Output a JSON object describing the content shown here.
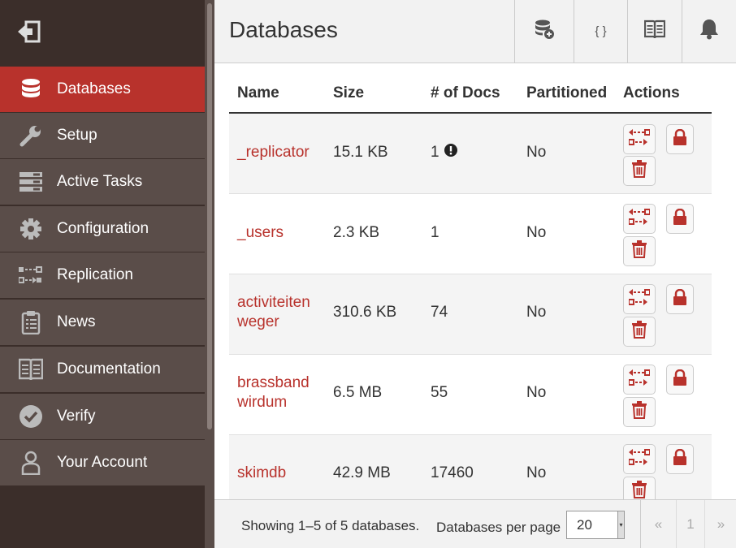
{
  "sidebar": {
    "items": [
      {
        "label": "Databases",
        "icon": "database-icon",
        "active": true
      },
      {
        "label": "Setup",
        "icon": "wrench-icon"
      },
      {
        "label": "Active Tasks",
        "icon": "tasks-icon"
      },
      {
        "label": "Configuration",
        "icon": "gear-icon"
      },
      {
        "label": "Replication",
        "icon": "replication-icon"
      },
      {
        "label": "News",
        "icon": "clipboard-icon"
      },
      {
        "label": "Documentation",
        "icon": "book-icon"
      },
      {
        "label": "Verify",
        "icon": "check-circle-icon"
      },
      {
        "label": "Your Account",
        "icon": "user-icon"
      }
    ]
  },
  "header": {
    "title": "Databases",
    "json_label": "{ }"
  },
  "table": {
    "columns": [
      "Name",
      "Size",
      "# of Docs",
      "Partitioned",
      "Actions"
    ],
    "rows": [
      {
        "name": "_replicator",
        "size": "15.1 KB",
        "docs": "1",
        "partitioned": "No",
        "warning": true
      },
      {
        "name": "_users",
        "size": "2.3 KB",
        "docs": "1",
        "partitioned": "No"
      },
      {
        "name": "activiteiten weger",
        "size": "310.6 KB",
        "docs": "74",
        "partitioned": "No"
      },
      {
        "name": "brassband wirdum",
        "size": "6.5 MB",
        "docs": "55",
        "partitioned": "No"
      },
      {
        "name": "skimdb",
        "size": "42.9 MB",
        "docs": "17460",
        "partitioned": "No"
      }
    ]
  },
  "footer": {
    "showing": "Showing 1–5 of 5 databases.",
    "per_page_label": "Databases per page",
    "per_page_value": "20",
    "pager": {
      "prev": "«",
      "page": "1",
      "next": "»"
    }
  },
  "colors": {
    "accent": "#b8322c",
    "sidebar_bg": "#3b2e2a",
    "sidebar_item": "#5a4d49"
  }
}
